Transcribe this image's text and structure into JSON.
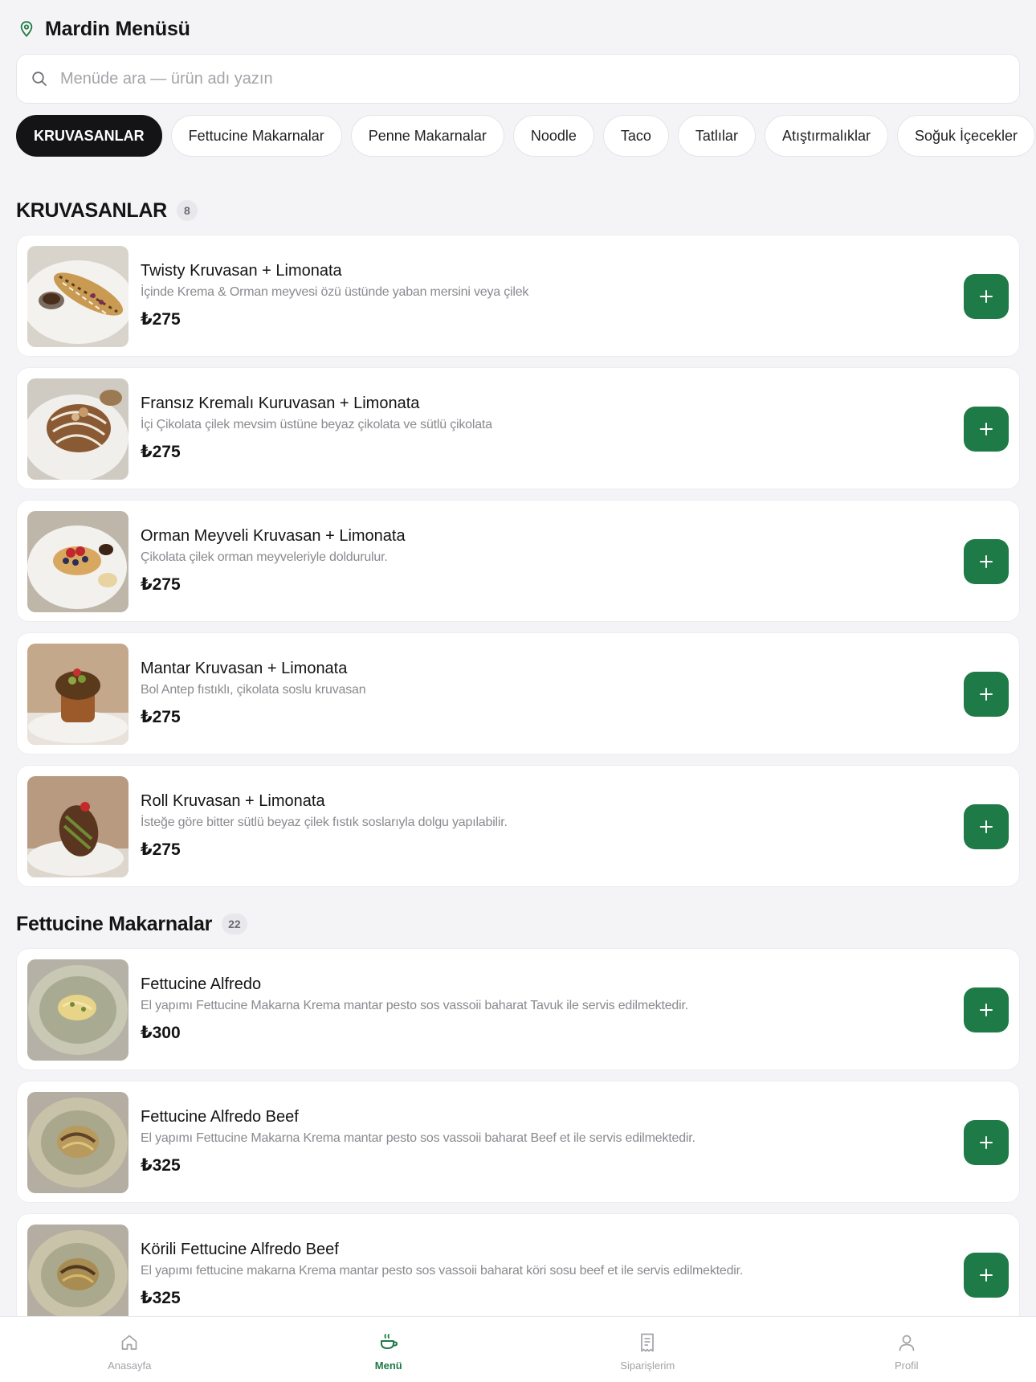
{
  "header": {
    "title": "Mardin Menüsü",
    "icon": "map-pin-icon"
  },
  "search": {
    "placeholder": "Menüde ara — ürün adı yazın",
    "value": ""
  },
  "categories": [
    "KRUVASANLAR",
    "Fettucine Makarnalar",
    "Penne Makarnalar",
    "Noodle",
    "Taco",
    "Tatlılar",
    "Atıştırmalıklar",
    "Soğuk İçecekler"
  ],
  "active_category": "KRUVASANLAR",
  "sections": [
    {
      "name": "KRUVASANLAR",
      "count": "8",
      "items": [
        {
          "name": "Twisty Kruvasan + Limonata",
          "desc": "İçinde Krema & Orman meyvesi özü üstünde yaban mersini veya çilek",
          "price": "₺275"
        },
        {
          "name": "Fransız Kremalı Kuruvasan + Limonata",
          "desc": "İçi Çikolata çilek mevsim üstüne beyaz çikolata ve sütlü çikolata",
          "price": "₺275"
        },
        {
          "name": "Orman Meyveli Kruvasan + Limonata",
          "desc": "Çikolata çilek orman meyveleriyle doldurulur.",
          "price": "₺275"
        },
        {
          "name": "Mantar Kruvasan + Limonata",
          "desc": "Bol Antep fıstıklı, çikolata soslu kruvasan",
          "price": "₺275"
        },
        {
          "name": "Roll Kruvasan + Limonata",
          "desc": "İsteğe göre bitter sütlü beyaz çilek fıstık soslarıyla dolgu yapılabilir.",
          "price": "₺275"
        }
      ]
    },
    {
      "name": "Fettucine Makarnalar",
      "count": "22",
      "items": [
        {
          "name": "Fettucine Alfredo",
          "desc": "El yapımı Fettucine Makarna Krema mantar pesto sos vassoii baharat Tavuk ile servis edilmektedir.",
          "price": "₺300"
        },
        {
          "name": "Fettucine Alfredo Beef",
          "desc": "El yapımı Fettucine Makarna Krema mantar pesto sos vassoii baharat Beef et ile servis edilmektedir.",
          "price": "₺325"
        },
        {
          "name": "Körili Fettucine Alfredo Beef",
          "desc": "El yapımı fettucine makarna Krema mantar pesto sos vassoii baharat köri sosu beef et ile servis edilmektedir.",
          "price": "₺325"
        }
      ]
    }
  ],
  "bottom_nav": [
    {
      "label": "Anasayfa",
      "icon": "home-icon"
    },
    {
      "label": "Menü",
      "icon": "coffee-cup-icon"
    },
    {
      "label": "Siparişlerim",
      "icon": "receipt-icon"
    },
    {
      "label": "Profil",
      "icon": "user-icon"
    }
  ],
  "active_nav": "Menü",
  "colors": {
    "accent": "#1e7a46",
    "background": "#f4f4f6",
    "chip_active": "#141417",
    "muted_text": "#8a8a90"
  }
}
